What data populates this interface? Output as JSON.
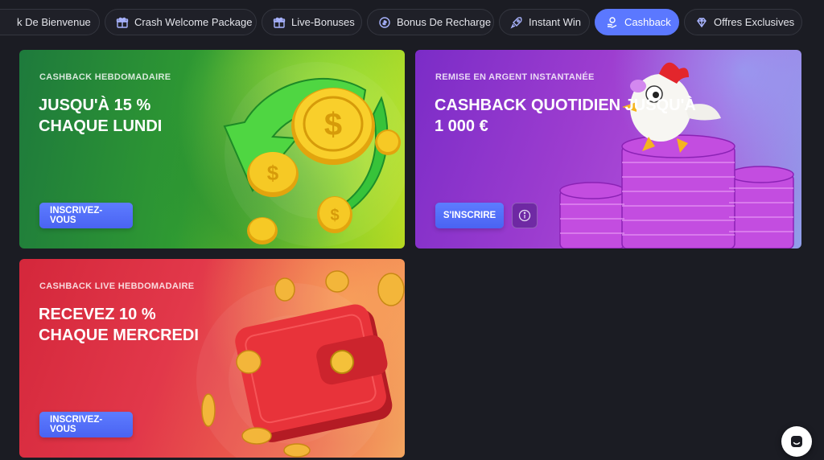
{
  "tabs": [
    {
      "label": "k De Bienvenue",
      "icon": "none",
      "active": false
    },
    {
      "label": "Crash Welcome Package",
      "icon": "gift-icon",
      "active": false
    },
    {
      "label": "Live-Bonuses",
      "icon": "gift-icon",
      "active": false
    },
    {
      "label": "Bonus De Recharge",
      "icon": "refresh-coin-icon",
      "active": false
    },
    {
      "label": "Instant Win",
      "icon": "rocket-icon",
      "active": false
    },
    {
      "label": "Cashback",
      "icon": "coin-hand-icon",
      "active": true
    },
    {
      "label": "Offres Exclusives",
      "icon": "diamond-icon",
      "active": false
    }
  ],
  "cards": {
    "weekly": {
      "kicker": "CASHBACK HEBDOMADAIRE",
      "title_line1": "JUSQU'À 15 %",
      "title_line2": "CHAQUE LUNDI",
      "cta": "INSCRIVEZ-VOUS"
    },
    "daily": {
      "kicker": "REMISE EN ARGENT INSTANTANÉE",
      "title_line1": "CASHBACK QUOTIDIEN JUSQU'À",
      "title_line2": "1 000 €",
      "cta": "S'INSCRIRE"
    },
    "live": {
      "kicker": "CASHBACK LIVE HEBDOMADAIRE",
      "title_line1": "RECEVEZ 10 %",
      "title_line2": "CHAQUE MERCREDI",
      "cta": "INSCRIVEZ-VOUS"
    }
  },
  "colors": {
    "accent": "#5b78ff",
    "background": "#1b1c23"
  }
}
